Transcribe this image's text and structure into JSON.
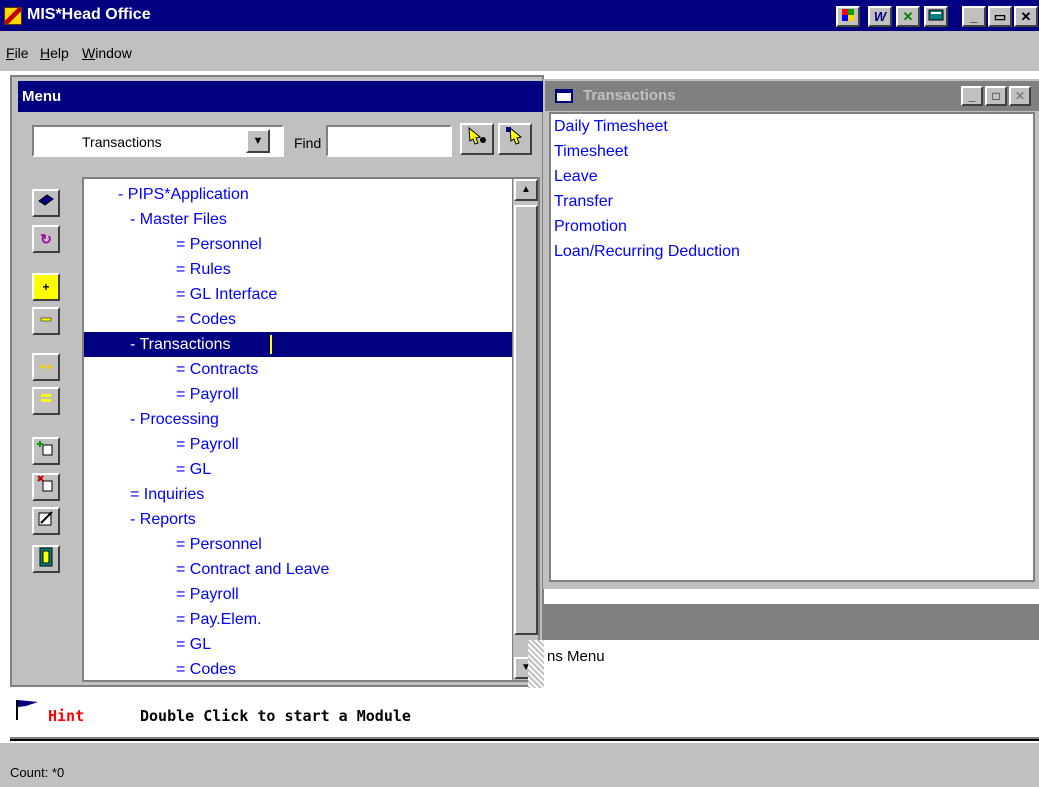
{
  "app": {
    "title": "MIS*Head Office",
    "titlebar_buttons": [
      "office-icon",
      "word-icon",
      "excel-icon",
      "access-icon"
    ],
    "window_controls": {
      "minimize": "_",
      "restore": "▭",
      "close": "✕"
    }
  },
  "menubar": {
    "items": [
      {
        "label": "File",
        "accel": "F"
      },
      {
        "label": "Help",
        "accel": "H"
      },
      {
        "label": "Window",
        "accel": "W"
      }
    ]
  },
  "menu_window": {
    "title": "Menu",
    "module_select": "Transactions",
    "find_label": "Find",
    "find_value": ""
  },
  "tree": {
    "items": [
      {
        "text": "- PIPS*Application",
        "level": 0
      },
      {
        "text": "- Master Files",
        "level": 1
      },
      {
        "text": "= Personnel",
        "level": 2
      },
      {
        "text": "= Rules",
        "level": 2
      },
      {
        "text": "= GL Interface",
        "level": 2
      },
      {
        "text": "= Codes",
        "level": 2
      },
      {
        "text": "- Transactions",
        "level": 1,
        "selected": true
      },
      {
        "text": "= Contracts",
        "level": 2
      },
      {
        "text": "= Payroll",
        "level": 2
      },
      {
        "text": "- Processing",
        "level": 1
      },
      {
        "text": "= Payroll",
        "level": 2
      },
      {
        "text": "= GL",
        "level": 2
      },
      {
        "text": "= Inquiries",
        "level": 1
      },
      {
        "text": "- Reports",
        "level": 1
      },
      {
        "text": "= Personnel",
        "level": 2
      },
      {
        "text": "= Contract and Leave",
        "level": 2
      },
      {
        "text": "= Payroll",
        "level": 2
      },
      {
        "text": "= Pay.Elem.",
        "level": 2
      },
      {
        "text": "= GL",
        "level": 2
      },
      {
        "text": "= Codes",
        "level": 2
      }
    ]
  },
  "transactions_window": {
    "title": "Transactions",
    "items": [
      "Daily Timesheet",
      "Timesheet",
      "Leave",
      "Transfer",
      "Promotion",
      "Loan/Recurring Deduction"
    ]
  },
  "background_text": "ns Menu",
  "hint": {
    "label": "Hint",
    "text": "Double Click to start a Module"
  },
  "status": {
    "text": "Count: *0"
  },
  "colors": {
    "titlebar": "#000080",
    "tree_text": "#0000ff",
    "hint_label": "#ff0000"
  }
}
